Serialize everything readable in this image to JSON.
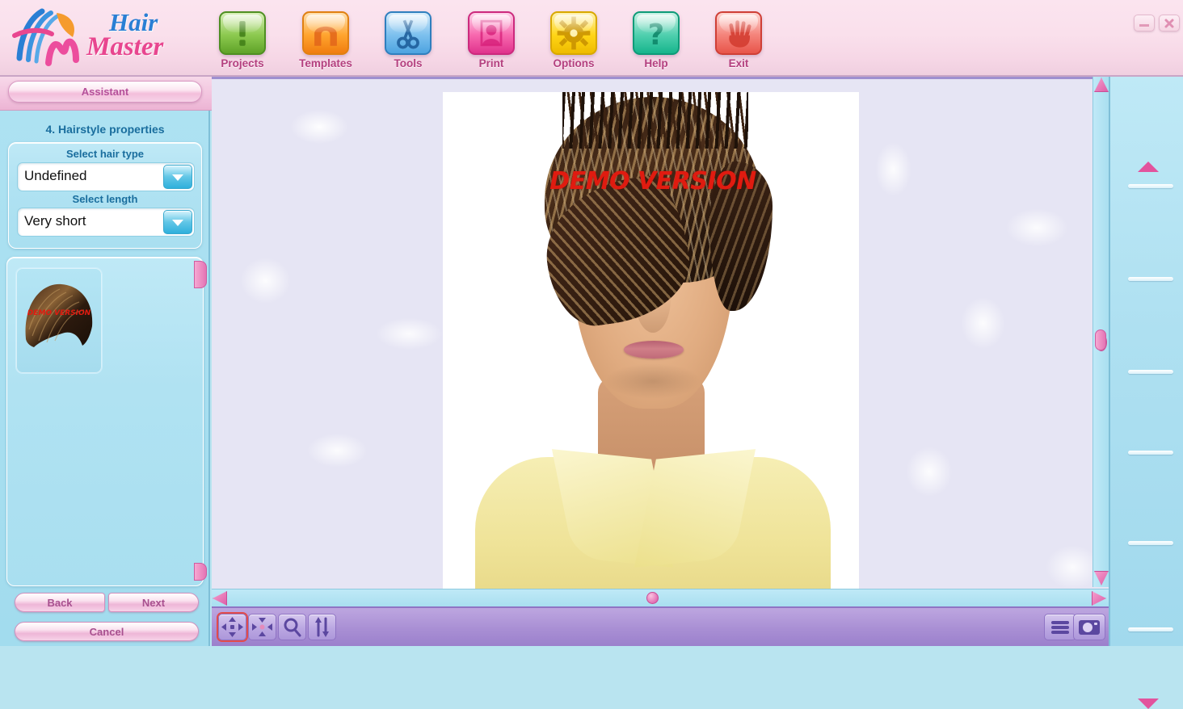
{
  "app": {
    "brand_line1": "Hair",
    "brand_line2": "Master",
    "logo_icon": "hairmaster-logo-icon"
  },
  "window_controls": {
    "minimize_icon": "minimize-icon",
    "close_icon": "close-icon"
  },
  "toolbar": {
    "buttons": [
      {
        "label": "Projects",
        "icon": "exclamation-icon",
        "color": "#8cc94f"
      },
      {
        "label": "Templates",
        "icon": "template-arch-icon",
        "color": "#ffa42e"
      },
      {
        "label": "Tools",
        "icon": "scissors-icon",
        "color": "#7cc0ee"
      },
      {
        "label": "Print",
        "icon": "printer-portrait-icon",
        "color": "#f768ae"
      },
      {
        "label": "Options",
        "icon": "gear-icon",
        "color": "#ffd516"
      },
      {
        "label": "Help",
        "icon": "question-mark-icon",
        "color": "#4fcfae"
      },
      {
        "label": "Exit",
        "icon": "hand-wave-icon",
        "color": "#f4837a"
      }
    ]
  },
  "sidebar": {
    "assistant_label": "Assistant",
    "step_title": "4. Hairstyle properties",
    "fields": [
      {
        "label": "Select hair type",
        "value": "Undefined",
        "name": "hair-type"
      },
      {
        "label": "Select length",
        "value": "Very short",
        "name": "hair-length"
      }
    ],
    "thumbnail_watermark": "DEMO VERSION",
    "nav": {
      "back": "Back",
      "next": "Next",
      "cancel": "Cancel"
    }
  },
  "canvas": {
    "watermark": "DEMO VERSION"
  },
  "bottombar": {
    "left_tools": [
      {
        "icon": "move-arrows-icon",
        "selected": true
      },
      {
        "icon": "resize-arrows-icon",
        "selected": false
      },
      {
        "icon": "magnifier-icon",
        "selected": false
      },
      {
        "icon": "flip-vertical-icon",
        "selected": false
      }
    ],
    "right_tools": [
      {
        "icon": "list-view-icon"
      },
      {
        "icon": "camera-icon"
      }
    ]
  },
  "right_panel": {
    "scroll_up_icon": "triangle-up-icon",
    "scroll_down_icon": "triangle-down-icon",
    "tick_count": 6
  },
  "colors": {
    "accent_pink": "#e8468f",
    "accent_blue": "#2a7fd4",
    "panel_cyan": "#a9dff0",
    "toolbar_pink": "#f6d7e6",
    "bottom_purple": "#a98fd4",
    "watermark_red": "#e01b10",
    "selection_red": "#e24b4b"
  }
}
